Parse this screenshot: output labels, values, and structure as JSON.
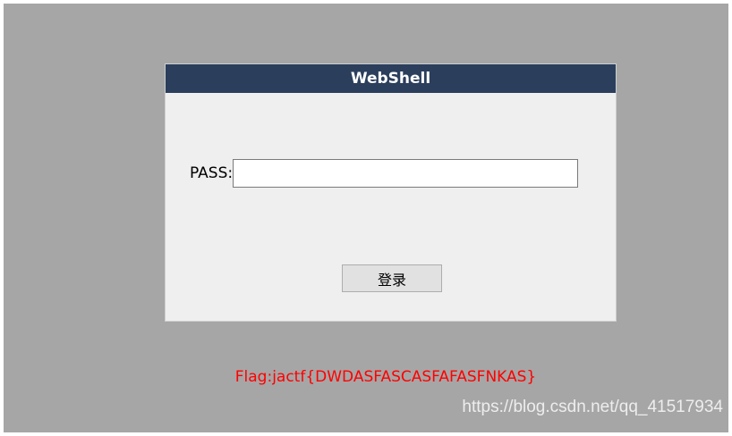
{
  "login_panel": {
    "title": "WebShell",
    "pass_label": "PASS:",
    "pass_value": "",
    "login_button_label": "登录"
  },
  "flag_text": "Flag:jactf{DWDASFASCASFAFASFNKAS}",
  "watermark": "https://blog.csdn.net/qq_41517934",
  "colors": {
    "page_background": "#a6a6a6",
    "panel_background": "#efefef",
    "header_background": "#2b3e5c",
    "flag_color": "#ff0000"
  }
}
